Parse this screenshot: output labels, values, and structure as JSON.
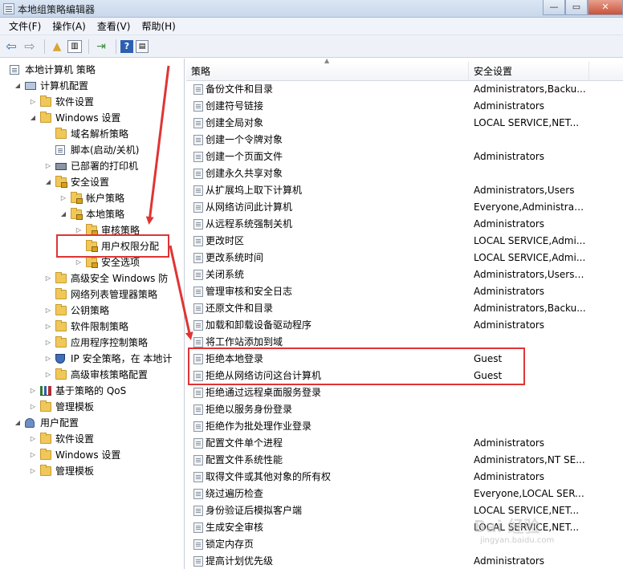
{
  "window": {
    "title": "本地组策略编辑器",
    "buttons": [
      "—",
      "▭",
      "✕"
    ]
  },
  "menubar": [
    {
      "label": "文件(F)"
    },
    {
      "label": "操作(A)"
    },
    {
      "label": "查看(V)"
    },
    {
      "label": "帮助(H)"
    }
  ],
  "toolbar": {
    "icons": [
      "back-icon",
      "forward-icon",
      "up-folder-icon",
      "show-tree-icon",
      "export-icon",
      "help-icon",
      "properties-icon"
    ],
    "glyphs": {
      "back": "⇦",
      "forward": "⇨",
      "up": "▲",
      "tree": "▥",
      "export": "⇥",
      "help": "?",
      "props": "▤"
    }
  },
  "tree": [
    {
      "label": "本地计算机 策略",
      "icon": "doc",
      "exp": ""
    },
    {
      "label": "计算机配置",
      "icon": "computer",
      "exp": "◢"
    },
    {
      "label": "软件设置",
      "icon": "folder",
      "exp": "▷"
    },
    {
      "label": "Windows 设置",
      "icon": "folder",
      "exp": "◢"
    },
    {
      "label": "域名解析策略",
      "icon": "folder",
      "exp": ""
    },
    {
      "label": "脚本(启动/关机)",
      "icon": "doc",
      "exp": ""
    },
    {
      "label": "已部署的打印机",
      "icon": "printer",
      "exp": "▷"
    },
    {
      "label": "安全设置",
      "icon": "folder-locked",
      "exp": "◢"
    },
    {
      "label": "帐户策略",
      "icon": "folder-locked",
      "exp": "▷"
    },
    {
      "label": "本地策略",
      "icon": "folder-locked",
      "exp": "◢"
    },
    {
      "label": "审核策略",
      "icon": "folder-locked",
      "exp": "▷"
    },
    {
      "label": "用户权限分配",
      "icon": "folder-locked",
      "exp": ""
    },
    {
      "label": "安全选项",
      "icon": "folder-locked",
      "exp": "▷"
    },
    {
      "label": "高级安全 Windows 防",
      "icon": "folder",
      "exp": "▷"
    },
    {
      "label": "网络列表管理器策略",
      "icon": "folder",
      "exp": ""
    },
    {
      "label": "公钥策略",
      "icon": "folder",
      "exp": "▷"
    },
    {
      "label": "软件限制策略",
      "icon": "folder",
      "exp": "▷"
    },
    {
      "label": "应用程序控制策略",
      "icon": "folder",
      "exp": "▷"
    },
    {
      "label": "IP 安全策略，在 本地计",
      "icon": "shield",
      "exp": "▷"
    },
    {
      "label": "高级审核策略配置",
      "icon": "folder",
      "exp": "▷"
    },
    {
      "label": "基于策略的 QoS",
      "icon": "chart",
      "exp": "▷"
    },
    {
      "label": "管理模板",
      "icon": "folder",
      "exp": "▷"
    },
    {
      "label": "用户配置",
      "icon": "user",
      "exp": "◢"
    },
    {
      "label": "软件设置",
      "icon": "folder",
      "exp": "▷"
    },
    {
      "label": "Windows 设置",
      "icon": "folder",
      "exp": "▷"
    },
    {
      "label": "管理模板",
      "icon": "folder",
      "exp": "▷"
    }
  ],
  "list": {
    "columns": {
      "policy": "策略",
      "setting": "安全设置"
    },
    "rows": [
      {
        "name": "备份文件和目录",
        "value": "Administrators,Backu..."
      },
      {
        "name": "创建符号链接",
        "value": "Administrators"
      },
      {
        "name": "创建全局对象",
        "value": "LOCAL SERVICE,NET..."
      },
      {
        "name": "创建一个令牌对象",
        "value": ""
      },
      {
        "name": "创建一个页面文件",
        "value": "Administrators"
      },
      {
        "name": "创建永久共享对象",
        "value": ""
      },
      {
        "name": "从扩展坞上取下计算机",
        "value": "Administrators,Users"
      },
      {
        "name": "从网络访问此计算机",
        "value": "Everyone,Administrat..."
      },
      {
        "name": "从远程系统强制关机",
        "value": "Administrators"
      },
      {
        "name": "更改时区",
        "value": "LOCAL SERVICE,Admi..."
      },
      {
        "name": "更改系统时间",
        "value": "LOCAL SERVICE,Admi..."
      },
      {
        "name": "关闭系统",
        "value": "Administrators,Users,..."
      },
      {
        "name": "管理审核和安全日志",
        "value": "Administrators"
      },
      {
        "name": "还原文件和目录",
        "value": "Administrators,Backu..."
      },
      {
        "name": "加载和卸载设备驱动程序",
        "value": "Administrators"
      },
      {
        "name": "将工作站添加到域",
        "value": ""
      },
      {
        "name": "拒绝本地登录",
        "value": "Guest"
      },
      {
        "name": "拒绝从网络访问这台计算机",
        "value": "Guest"
      },
      {
        "name": "拒绝通过远程桌面服务登录",
        "value": ""
      },
      {
        "name": "拒绝以服务身份登录",
        "value": ""
      },
      {
        "name": "拒绝作为批处理作业登录",
        "value": ""
      },
      {
        "name": "配置文件单个进程",
        "value": "Administrators"
      },
      {
        "name": "配置文件系统性能",
        "value": "Administrators,NT SE..."
      },
      {
        "name": "取得文件或其他对象的所有权",
        "value": "Administrators"
      },
      {
        "name": "绕过遍历检查",
        "value": "Everyone,LOCAL SERV..."
      },
      {
        "name": "身份验证后模拟客户端",
        "value": "LOCAL SERVICE,NET..."
      },
      {
        "name": "生成安全审核",
        "value": "LOCAL SERVICE,NET..."
      },
      {
        "name": "锁定内存页",
        "value": ""
      },
      {
        "name": "提高计划优先级",
        "value": "Administrators"
      }
    ]
  },
  "watermark": {
    "text": "Bai 经验",
    "url": "jingyan.baidu.com"
  },
  "colors": {
    "annotation": "#e03434",
    "folder": "#f0c85a",
    "accent": "#2b68b8"
  }
}
